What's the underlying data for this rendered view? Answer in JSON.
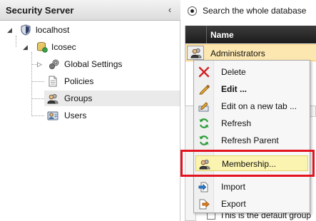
{
  "panel": {
    "title": "Security Server",
    "collapse_glyph": "‹"
  },
  "tree": {
    "root": {
      "label": "localhost",
      "icon": "shield-icon",
      "expander": "◢"
    },
    "app": {
      "label": "Icosec",
      "icon": "database-icon",
      "expander": "◢"
    },
    "children": [
      {
        "label": "Global Settings",
        "icon": "gears-icon",
        "expander": "▷"
      },
      {
        "label": "Policies",
        "icon": "document-icon"
      },
      {
        "label": "Groups",
        "icon": "group-icon"
      },
      {
        "label": "Users",
        "icon": "users-icon"
      }
    ]
  },
  "search": {
    "option_label": "Search the whole database"
  },
  "grid": {
    "columns": [
      "Name"
    ],
    "rows": [
      {
        "name": "Administrators",
        "icon": "group-icon"
      }
    ]
  },
  "detail": {
    "text": "This is the default group"
  },
  "context_menu": {
    "items": [
      {
        "label": "Delete",
        "icon": "delete-icon"
      },
      {
        "label": "Edit ...",
        "icon": "pencil-icon"
      },
      {
        "label": "Edit on a new tab ...",
        "icon": "edit-tab-icon"
      },
      {
        "label": "Refresh",
        "icon": "refresh-icon"
      },
      {
        "label": "Refresh Parent",
        "icon": "refresh-icon"
      },
      {
        "label": "Membership...",
        "icon": "membership-icon"
      },
      {
        "label": "Import",
        "icon": "import-icon"
      },
      {
        "label": "Export",
        "icon": "export-icon"
      }
    ]
  },
  "colors": {
    "highlight_outline": "#e3141f",
    "selected_row": "#fde7b0",
    "menu_hover": "#fbf4b0"
  }
}
